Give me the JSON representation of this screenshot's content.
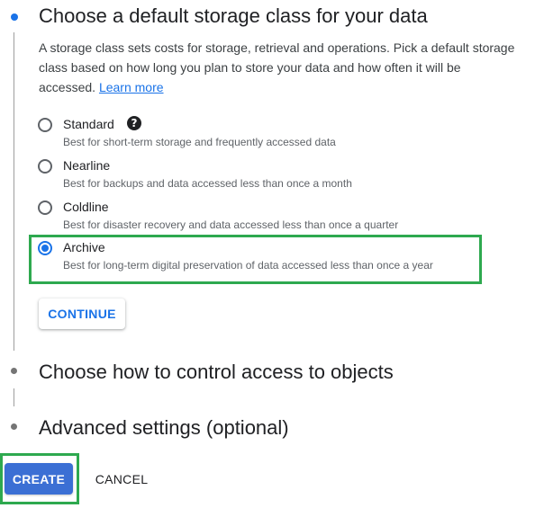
{
  "steps": {
    "storage_class": {
      "title": "Choose a default storage class for your data",
      "description": "A storage class sets costs for storage, retrieval and operations. Pick a default storage class based on how long you plan to store your data and how often it will be accessed.",
      "learn_more": "Learn more",
      "options": [
        {
          "label": "Standard",
          "description": "Best for short-term storage and frequently accessed data",
          "selected": false,
          "help_icon": "question-mark-circle"
        },
        {
          "label": "Nearline",
          "description": "Best for backups and data accessed less than once a month",
          "selected": false
        },
        {
          "label": "Coldline",
          "description": "Best for disaster recovery and data accessed less than once a quarter",
          "selected": false
        },
        {
          "label": "Archive",
          "description": "Best for long-term digital preservation of data accessed less than once a year",
          "selected": true
        }
      ],
      "continue_label": "CONTINUE"
    },
    "access_control": {
      "title": "Choose how to control access to objects"
    },
    "advanced": {
      "title": "Advanced settings (optional)"
    }
  },
  "actions": {
    "create_label": "CREATE",
    "cancel_label": "CANCEL"
  },
  "colors": {
    "accent": "#1a73e8",
    "create_button": "#3b6fd4",
    "highlight_box": "#2ea94f"
  },
  "help_icon_glyph": "?"
}
